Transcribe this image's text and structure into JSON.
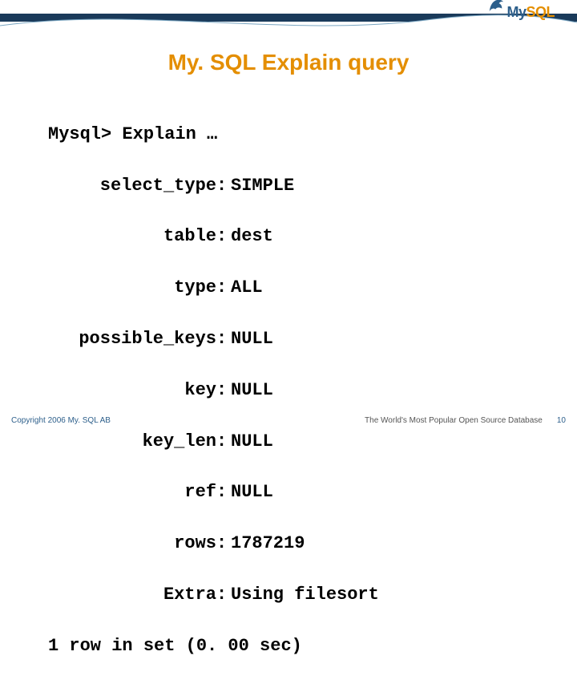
{
  "logo": {
    "my": "My",
    "sql": "SQL"
  },
  "title": "My. SQL Explain query",
  "explain": {
    "prompt": "Mysql> Explain …",
    "rows": [
      {
        "k": "select_type",
        "v": "SIMPLE"
      },
      {
        "k": "table",
        "v": "dest"
      },
      {
        "k": "type",
        "v": "ALL"
      },
      {
        "k": "possible_keys",
        "v": "NULL"
      },
      {
        "k": "key",
        "v": "NULL"
      },
      {
        "k": "key_len",
        "v": "NULL"
      },
      {
        "k": "ref",
        "v": "NULL"
      },
      {
        "k": "rows",
        "v": "1787219"
      },
      {
        "k": "Extra",
        "v": "Using filesort"
      }
    ],
    "summary": "1 row in set (0. 00 sec)"
  },
  "footer": {
    "copyright": "Copyright 2006 My. SQL AB",
    "tagline": "The World's Most Popular Open Source Database",
    "page": "10"
  }
}
